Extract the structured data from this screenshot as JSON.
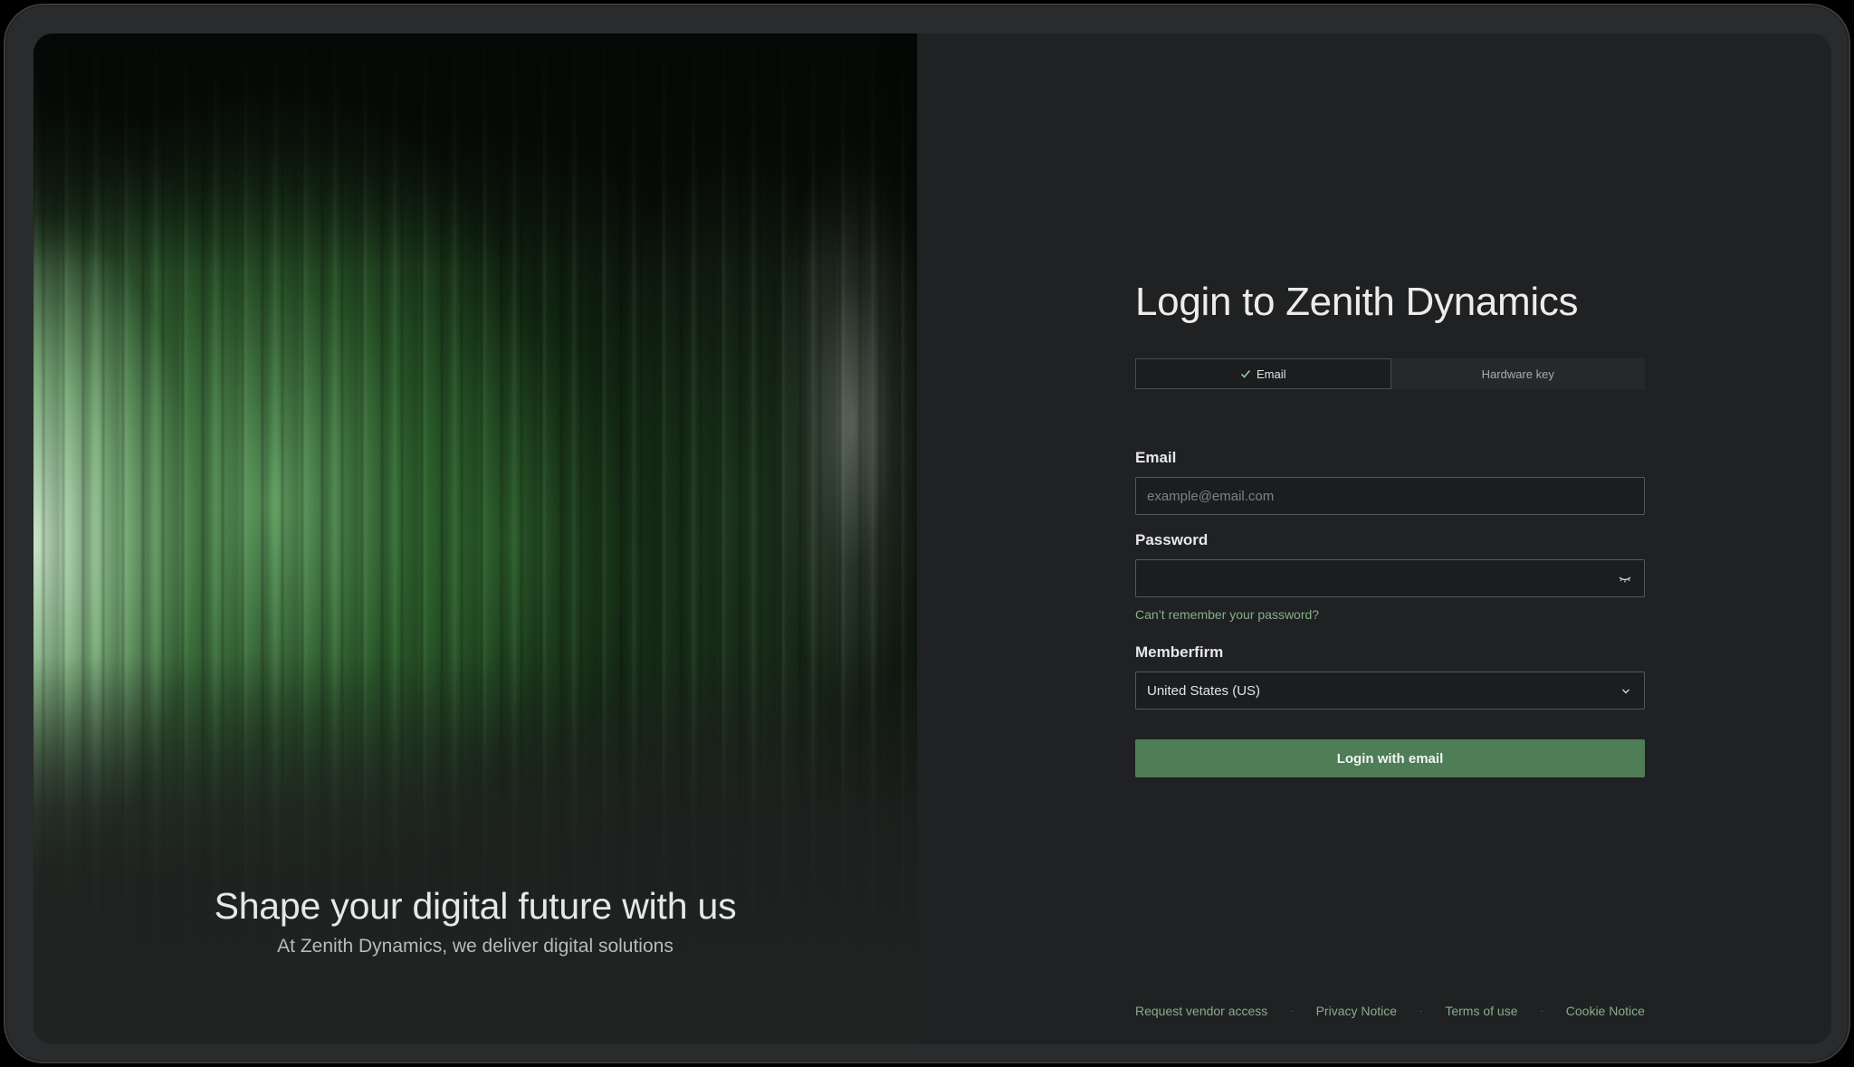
{
  "hero": {
    "title": "Shape your digital future with us",
    "subtitle": "At Zenith Dynamics, we deliver digital solutions"
  },
  "login": {
    "title": "Login to Zenith Dynamics",
    "tabs": [
      {
        "label": "Email",
        "active": true,
        "icon": "check-icon"
      },
      {
        "label": "Hardware key",
        "active": false
      }
    ],
    "email": {
      "label": "Email",
      "value": "",
      "placeholder": "example@email.com"
    },
    "password": {
      "label": "Password",
      "value": "",
      "toggle_icon": "eye-closed-icon"
    },
    "forgot_link": "Can’t remember your password?",
    "memberfirm": {
      "label": "Memberfirm",
      "selected": "United States (US)",
      "icon": "chevron-down-icon"
    },
    "submit_label": "Login with email"
  },
  "footer": {
    "links": [
      "Request vendor access",
      "Privacy Notice",
      "Terms of use",
      "Cookie Notice"
    ],
    "separator": "·"
  },
  "colors": {
    "accent_green": "#4f7d56",
    "link_green": "#86ad8b",
    "panel_bg": "#202123"
  }
}
